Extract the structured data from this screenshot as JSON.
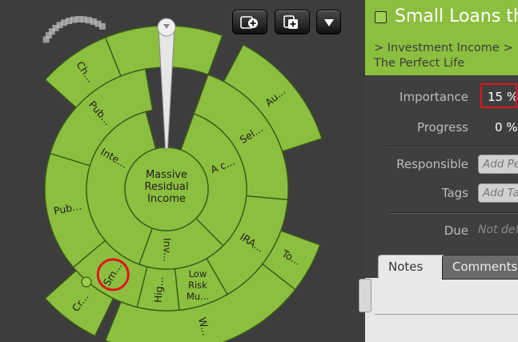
{
  "toolbar": {
    "add_child_icon": "add-child-icon",
    "add_sibling_icon": "add-sibling-icon",
    "menu_icon": "dropdown-triangle-icon"
  },
  "sunburst": {
    "center_label": "Massive Residual Income",
    "colors": {
      "fill": "#8cbf3f",
      "stroke": "#3a5a1a",
      "highlight": "#e0141e",
      "background": "#3d3d3d",
      "mini": "#bbbbbb"
    },
    "ring1": [
      "A c...",
      "Inv...",
      "Inte..."
    ],
    "ring2": [
      "Sel...",
      "IRA...",
      "Low Risk Mu...",
      "Hig...",
      "Sm...",
      "Pub...",
      "Pub..."
    ],
    "ring3": [
      "To...",
      "W...",
      "Cr...",
      "Ch...",
      "Ch...",
      "Au..."
    ],
    "highlighted_segment": "Sm..."
  },
  "panel": {
    "title": "Small Loans th",
    "breadcrumb_line1": "> Investment Income  >",
    "breadcrumb_line2": "The Perfect Life",
    "importance_label": "Importance",
    "importance_value": "15 %",
    "progress_label": "Progress",
    "progress_value": "0 %",
    "responsible_label": "Responsible",
    "responsible_placeholder": "Add Pe",
    "tags_label": "Tags",
    "tags_placeholder": "Add Ta",
    "due_label": "Due",
    "due_value": "Not def",
    "tabs": [
      {
        "label": "Notes"
      },
      {
        "label": "Comments"
      }
    ]
  }
}
